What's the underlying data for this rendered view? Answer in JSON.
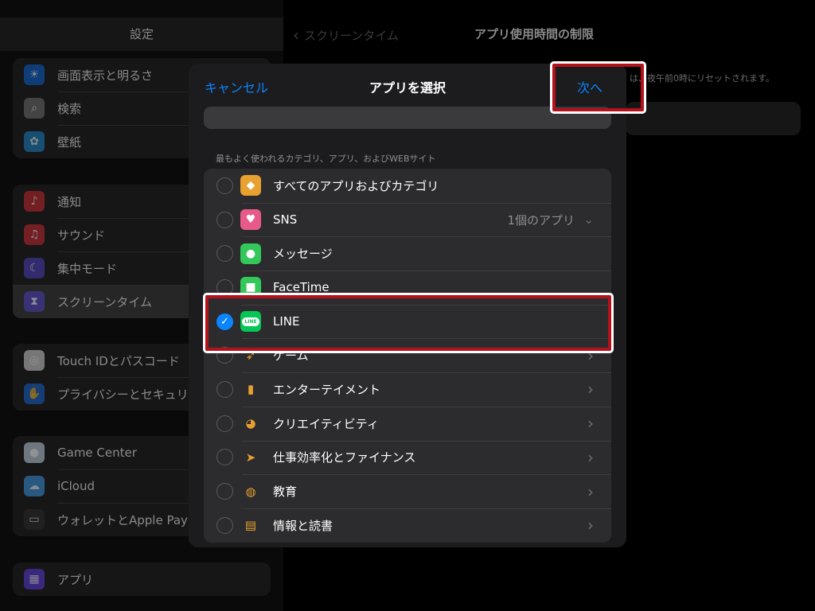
{
  "sidebar": {
    "title": "設定",
    "groups": [
      {
        "items": [
          {
            "label": "画面表示と明るさ",
            "icon": "sun-icon",
            "color": "#0a60c8"
          },
          {
            "label": "検索",
            "icon": "search-icon",
            "color": "#6b6b6b"
          },
          {
            "label": "壁紙",
            "icon": "flower-icon",
            "color": "#1a7fc0"
          }
        ]
      },
      {
        "items": [
          {
            "label": "通知",
            "icon": "bell-icon",
            "color": "#c0282f"
          },
          {
            "label": "サウンド",
            "icon": "speaker-icon",
            "color": "#c0282f"
          },
          {
            "label": "集中モード",
            "icon": "moon-icon",
            "color": "#4a3fb8"
          },
          {
            "label": "スクリーンタイム",
            "icon": "hourglass-icon",
            "color": "#4a3fb8",
            "active": true
          }
        ]
      },
      {
        "items": [
          {
            "label": "Touch IDとパスコード",
            "icon": "fingerprint-icon",
            "color": "#c9c9c9"
          },
          {
            "label": "プライバシーとセキュリティ",
            "icon": "hand-icon",
            "color": "#1a5fc8"
          }
        ]
      },
      {
        "items": [
          {
            "label": "Game Center",
            "icon": "game-center-icon",
            "color": "#b8c8d8"
          },
          {
            "label": "iCloud",
            "icon": "cloud-icon",
            "color": "#3a8ed8"
          },
          {
            "label": "ウォレットとApple Pay",
            "icon": "wallet-icon",
            "color": "#2a2a2a"
          }
        ]
      },
      {
        "items": [
          {
            "label": "アプリ",
            "icon": "apps-grid-icon",
            "color": "#5a3ad8"
          }
        ]
      }
    ]
  },
  "detail": {
    "back_label": "スクリーンタイム",
    "title": "アプリ使用時間の制限",
    "note": "は、夜午前0時にリセットされます。"
  },
  "sheet": {
    "cancel_label": "キャンセル",
    "title": "アプリを選択",
    "next_label": "次へ",
    "search_placeholder": "",
    "section_label": "最もよく使われるカテゴリ、アプリ、およびWEBサイト",
    "rows": [
      {
        "label": "すべてのアプリおよびカテゴリ",
        "icon": "layers-icon",
        "glyph": "◆",
        "color": "#e8a030",
        "checked": false,
        "detail": "",
        "chevron": false
      },
      {
        "label": "SNS",
        "icon": "social-bubble-icon",
        "glyph": "♥",
        "color": "#e85a8a",
        "checked": false,
        "detail": "1個のアプリ",
        "chevron": "down"
      },
      {
        "label": "メッセージ",
        "icon": "messages-icon",
        "glyph": "●",
        "color": "#34c759",
        "checked": false,
        "detail": "",
        "chevron": false
      },
      {
        "label": "FaceTime",
        "icon": "facetime-icon",
        "glyph": "■",
        "color": "#34c759",
        "checked": false,
        "detail": "",
        "chevron": false
      },
      {
        "label": "LINE",
        "icon": "line-app-icon",
        "glyph": "LINE",
        "color": "#06c755",
        "checked": true,
        "detail": "",
        "chevron": false
      },
      {
        "label": "ゲーム",
        "icon": "rocket-icon",
        "glyph": "➶",
        "color": "#2c2c2e",
        "checked": false,
        "detail": "",
        "chevron": "right"
      },
      {
        "label": "エンターテイメント",
        "icon": "popcorn-icon",
        "glyph": "▮",
        "color": "#2c2c2e",
        "checked": false,
        "detail": "",
        "chevron": "right"
      },
      {
        "label": "クリエイティビティ",
        "icon": "palette-icon",
        "glyph": "◕",
        "color": "#2c2c2e",
        "checked": false,
        "detail": "",
        "chevron": "right"
      },
      {
        "label": "仕事効率化とファイナンス",
        "icon": "paper-plane-icon",
        "glyph": "➤",
        "color": "#2c2c2e",
        "checked": false,
        "detail": "",
        "chevron": "right"
      },
      {
        "label": "教育",
        "icon": "globe-icon",
        "glyph": "◍",
        "color": "#2c2c2e",
        "checked": false,
        "detail": "",
        "chevron": "right"
      },
      {
        "label": "情報と読書",
        "icon": "book-icon",
        "glyph": "▤",
        "color": "#2c2c2e",
        "checked": false,
        "detail": "",
        "chevron": "right"
      }
    ]
  },
  "colors": {
    "accent": "#0a84ff",
    "highlight": "#b3121d"
  }
}
